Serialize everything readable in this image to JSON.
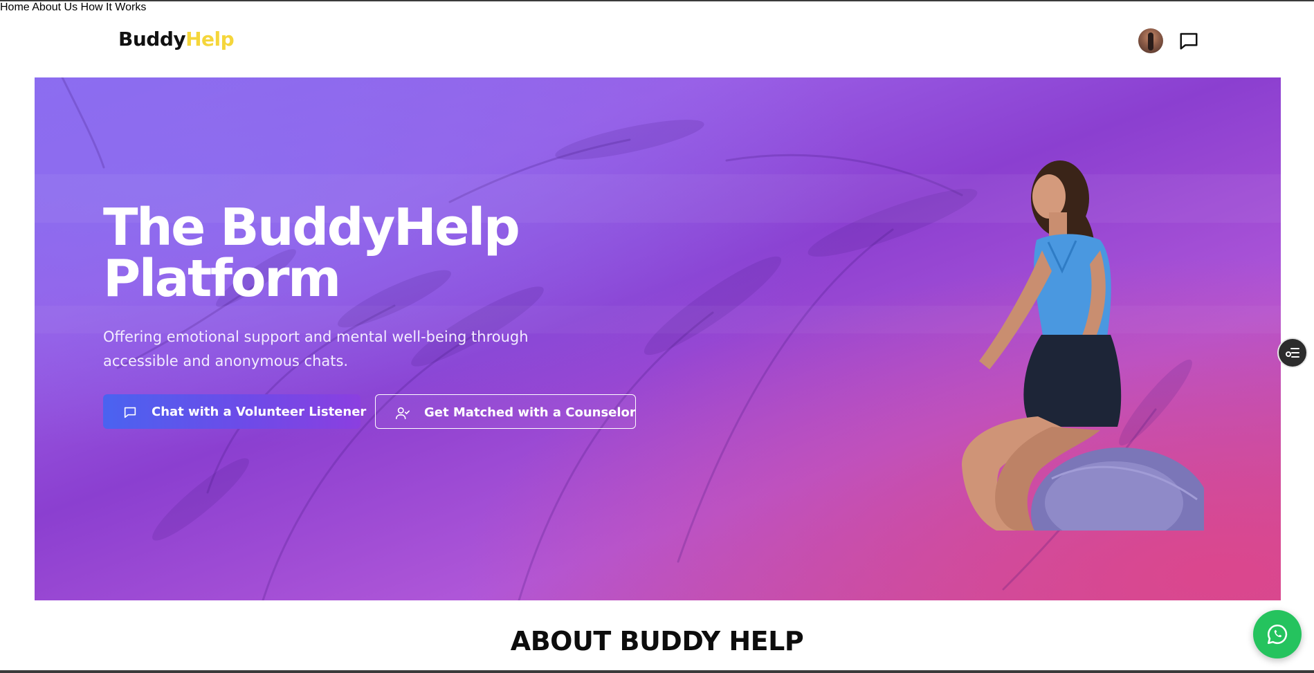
{
  "header": {
    "logo_part1": "Buddy",
    "logo_part2": "Help",
    "nav": [
      {
        "label": "Home"
      },
      {
        "label": "About Us"
      },
      {
        "label": "How It Works"
      }
    ],
    "avatar_icon": "user-avatar",
    "message_icon": "message-square-icon"
  },
  "hero": {
    "title_line1": "The BuddyHelp",
    "title_line2": "Platform",
    "subtitle_line1": "Offering emotional support and mental well-being through",
    "subtitle_line2": "accessible and anonymous chats.",
    "primary_button": {
      "label": "Chat with a Volunteer Listener",
      "icon": "message-square-icon"
    },
    "secondary_button": {
      "label": "Get Matched with a Counselor",
      "icon": "user-check-icon"
    },
    "image_subject": "woman meditating on exercise ball"
  },
  "about": {
    "heading": "ABOUT BUDDY HELP"
  },
  "floating": {
    "side_widget_icon": "list-settings-icon",
    "whatsapp_icon": "whatsapp-icon"
  },
  "colors": {
    "logo_accent": "#f5d63b",
    "hero_start": "#8a6cf0",
    "hero_end": "#c8509c",
    "primary_button": "#5a56ec",
    "whatsapp": "#25c35e"
  }
}
